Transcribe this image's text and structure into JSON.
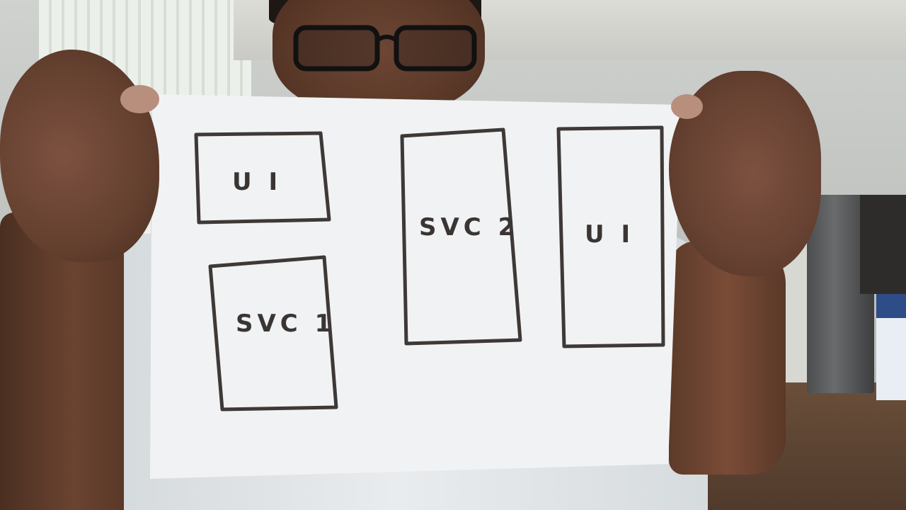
{
  "sketch": {
    "boxes": [
      {
        "label": "U I"
      },
      {
        "label": "SVC 2"
      },
      {
        "label": "U I"
      },
      {
        "label": "SVC 1"
      }
    ]
  }
}
